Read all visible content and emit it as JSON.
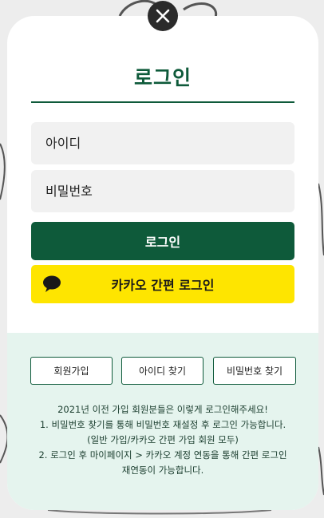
{
  "modal": {
    "title": "로그인",
    "id_placeholder": "아이디",
    "pw_placeholder": "비밀번호",
    "login_button": "로그인",
    "kakao_button": "카카오 간편 로그인"
  },
  "links": {
    "join": "회원가입",
    "find_id": "아이디 찾기",
    "find_pw": "비밀번호 찾기"
  },
  "notice": {
    "line1": "2021년 이전 가입 회원분들은 이렇게 로그인해주세요!",
    "line2": "1. 비밀번호 찾기를 통해 비밀번호 재설정 후 로그인 가능합니다.",
    "line3": "(일반 가입/카카오 간편 가입 회원 모두)",
    "line4": "2. 로그인 후 마이페이지 > 카카오 계정 연동을 통해 간편 로그인",
    "line5": "재연동이 가능합니다."
  },
  "colors": {
    "brand_green": "#0e5a3a",
    "kakao_yellow": "#fee500",
    "lower_bg": "#e5f4ee"
  },
  "icons": {
    "close": "close-icon",
    "kakao": "kakao-chat-bubble-icon"
  }
}
